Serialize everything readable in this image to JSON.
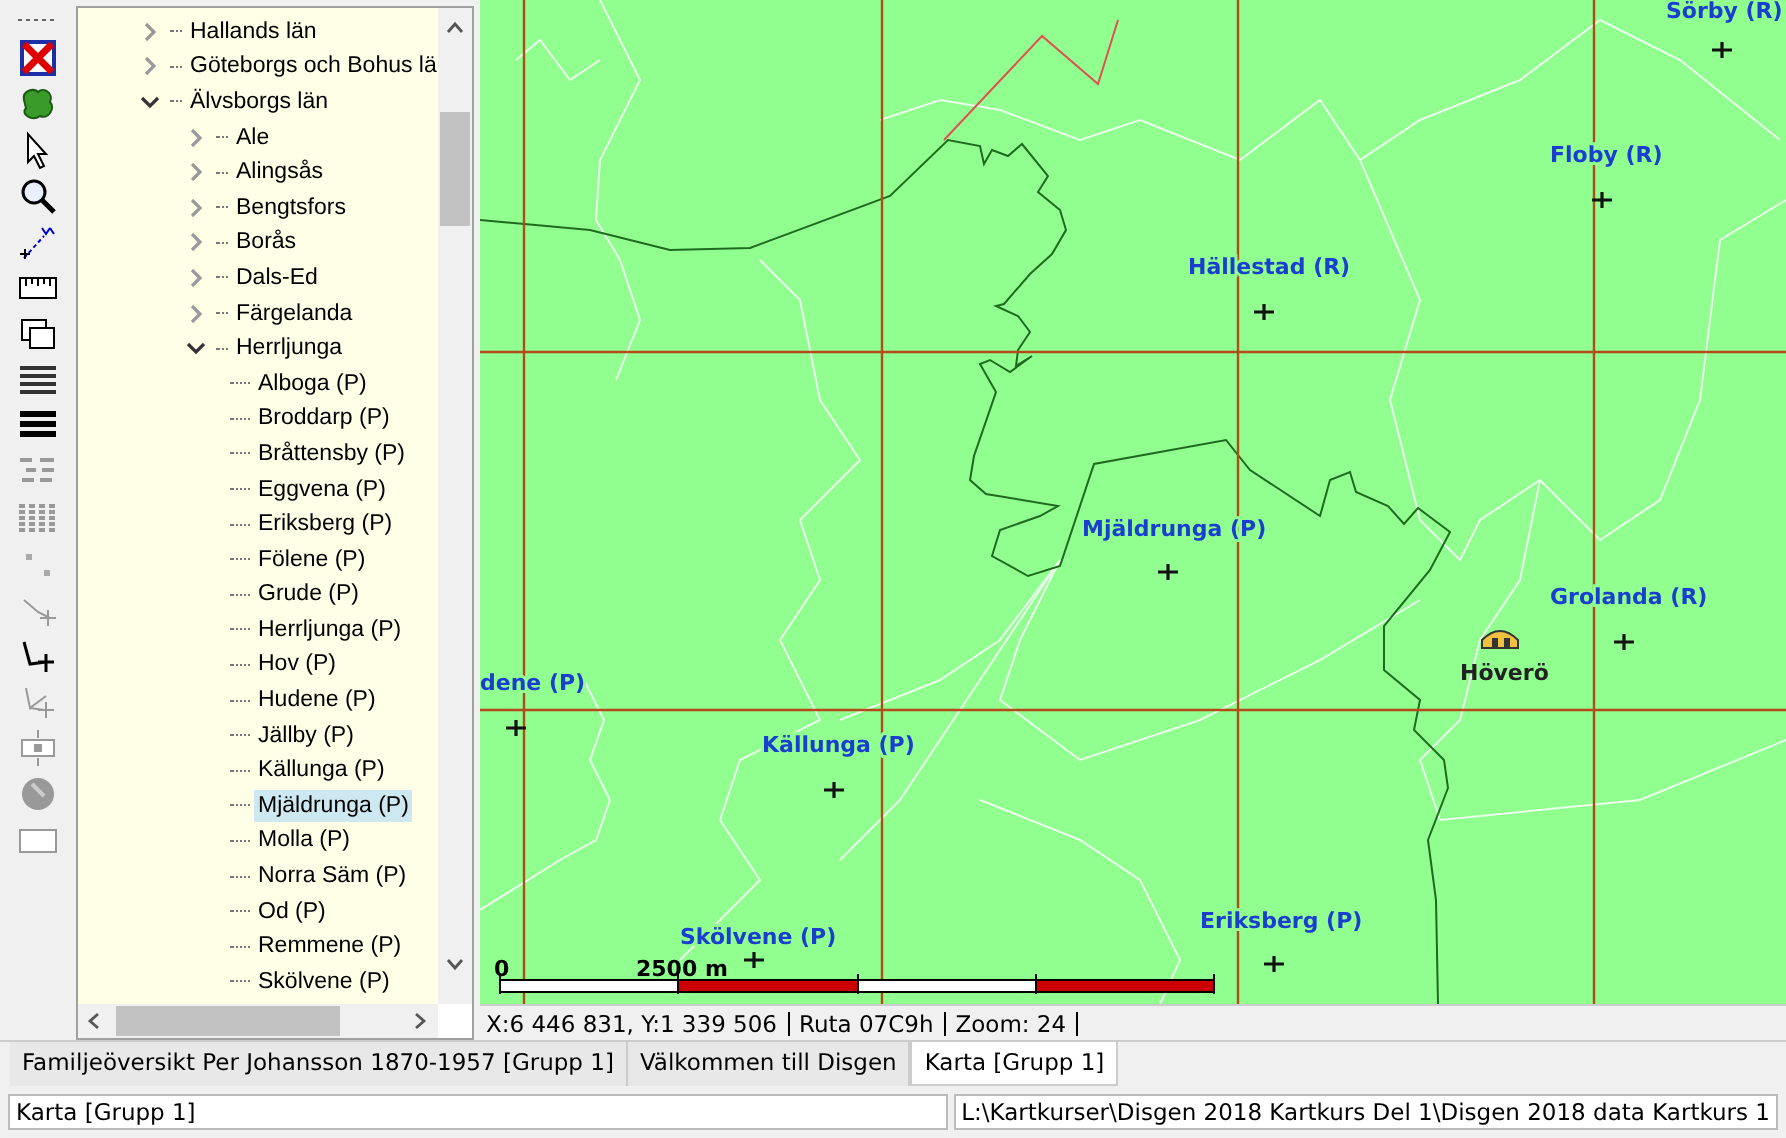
{
  "tree": [
    {
      "label": "Hallands län",
      "expanded": false,
      "selected": false
    },
    {
      "label": "Göteborgs och Bohus lä",
      "expanded": false,
      "selected": false
    },
    {
      "label": "Älvsborgs län",
      "expanded": true,
      "selected": false,
      "children": [
        {
          "label": "Ale",
          "expanded": false,
          "selected": false
        },
        {
          "label": "Alingsås",
          "expanded": false,
          "selected": false
        },
        {
          "label": "Bengtsfors",
          "expanded": false,
          "selected": false
        },
        {
          "label": "Borås",
          "expanded": false,
          "selected": false
        },
        {
          "label": "Dals-Ed",
          "expanded": false,
          "selected": false
        },
        {
          "label": "Färgelanda",
          "expanded": false,
          "selected": false
        },
        {
          "label": "Herrljunga",
          "expanded": true,
          "selected": false,
          "children": [
            {
              "label": "Alboga (P)",
              "selected": false
            },
            {
              "label": "Broddarp (P)",
              "selected": false
            },
            {
              "label": "Bråttensby (P)",
              "selected": false
            },
            {
              "label": "Eggvena (P)",
              "selected": false
            },
            {
              "label": "Eriksberg (P)",
              "selected": false
            },
            {
              "label": "Fölene (P)",
              "selected": false
            },
            {
              "label": "Grude (P)",
              "selected": false
            },
            {
              "label": "Herrljunga (P)",
              "selected": false
            },
            {
              "label": "Hov (P)",
              "selected": false
            },
            {
              "label": "Hudene (P)",
              "selected": false
            },
            {
              "label": "Jällby (P)",
              "selected": false
            },
            {
              "label": "Källunga (P)",
              "selected": false
            },
            {
              "label": "Mjäldrunga (P)",
              "selected": true
            },
            {
              "label": "Molla (P)",
              "selected": false
            },
            {
              "label": "Norra Säm (P)",
              "selected": false
            },
            {
              "label": "Od (P)",
              "selected": false
            },
            {
              "label": "Remmene (P)",
              "selected": false
            },
            {
              "label": "Skölvene (P)",
              "selected": false
            }
          ]
        }
      ]
    }
  ],
  "map": {
    "places": [
      {
        "label": "Sörby (R)",
        "kind": "place"
      },
      {
        "label": "Floby (R)",
        "kind": "place"
      },
      {
        "label": "Hällestad (R)",
        "kind": "place"
      },
      {
        "label": "Mjäldrunga (P)",
        "kind": "place"
      },
      {
        "label": "Grolanda (R)",
        "kind": "place"
      },
      {
        "label": "dene (P)",
        "kind": "place"
      },
      {
        "label": "Höverö",
        "kind": "farm"
      },
      {
        "label": "Källunga (P)",
        "kind": "place"
      },
      {
        "label": "Eriksberg (P)",
        "kind": "place"
      },
      {
        "label": "Skölvene (P)",
        "kind": "place"
      }
    ],
    "scale": {
      "start": "0",
      "mark": "2500 m"
    }
  },
  "map_status": [
    "X:6 446 831, Y:1 339 506",
    "Ruta 07C9h",
    "Zoom: 24"
  ],
  "tabs": [
    {
      "label": "Familjeöversikt Per Johansson 1870-1957 [Grupp 1]",
      "selected": false
    },
    {
      "label": "Välkommen till Disgen",
      "selected": false
    },
    {
      "label": "Karta [Grupp 1]",
      "selected": true
    }
  ],
  "status_bar": {
    "left": "Karta [Grupp 1]",
    "right": "L:\\Kartkurser\\Disgen 2018 Kartkurs Del 1\\Disgen 2018 data Kartkurs 1"
  }
}
